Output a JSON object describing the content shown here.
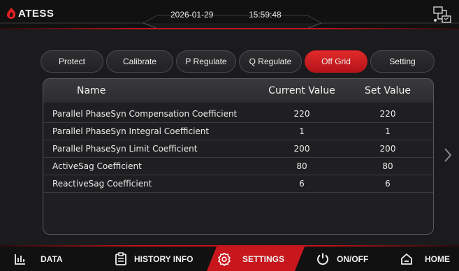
{
  "header": {
    "logo_text": "ATESS",
    "date": "2026-01-29",
    "time": "15:59:48",
    "accent_color": "#c0141b"
  },
  "tabs": [
    {
      "label": "Protect",
      "active": false
    },
    {
      "label": "Calibrate",
      "active": false
    },
    {
      "label": "P Regulate",
      "active": false
    },
    {
      "label": "Q Regulate",
      "active": false
    },
    {
      "label": "Off Grid",
      "active": true
    },
    {
      "label": "Setting",
      "active": false
    }
  ],
  "table": {
    "columns": [
      "Name",
      "Current Value",
      "Set Value"
    ],
    "rows": [
      {
        "name": "Parallel PhaseSyn Compensation Coefficient",
        "current": "220",
        "set": "220"
      },
      {
        "name": "Parallel PhaseSyn Integral Coefficient",
        "current": "1",
        "set": "1"
      },
      {
        "name": "Parallel PhaseSyn Limit Coefficient",
        "current": "200",
        "set": "200"
      },
      {
        "name": "ActiveSag Coefficient",
        "current": "80",
        "set": "80"
      },
      {
        "name": "ReactiveSag Coefficient",
        "current": "6",
        "set": "6"
      }
    ]
  },
  "bottom_nav": [
    {
      "label": "DATA",
      "icon": "bar-chart-icon",
      "active": false
    },
    {
      "label": "HISTORY INFO",
      "icon": "clipboard-icon",
      "active": false
    },
    {
      "label": "SETTINGS",
      "icon": "gear-icon",
      "active": true
    },
    {
      "label": "ON/OFF",
      "icon": "power-icon",
      "active": false
    },
    {
      "label": "HOME",
      "icon": "home-icon",
      "active": false
    }
  ]
}
